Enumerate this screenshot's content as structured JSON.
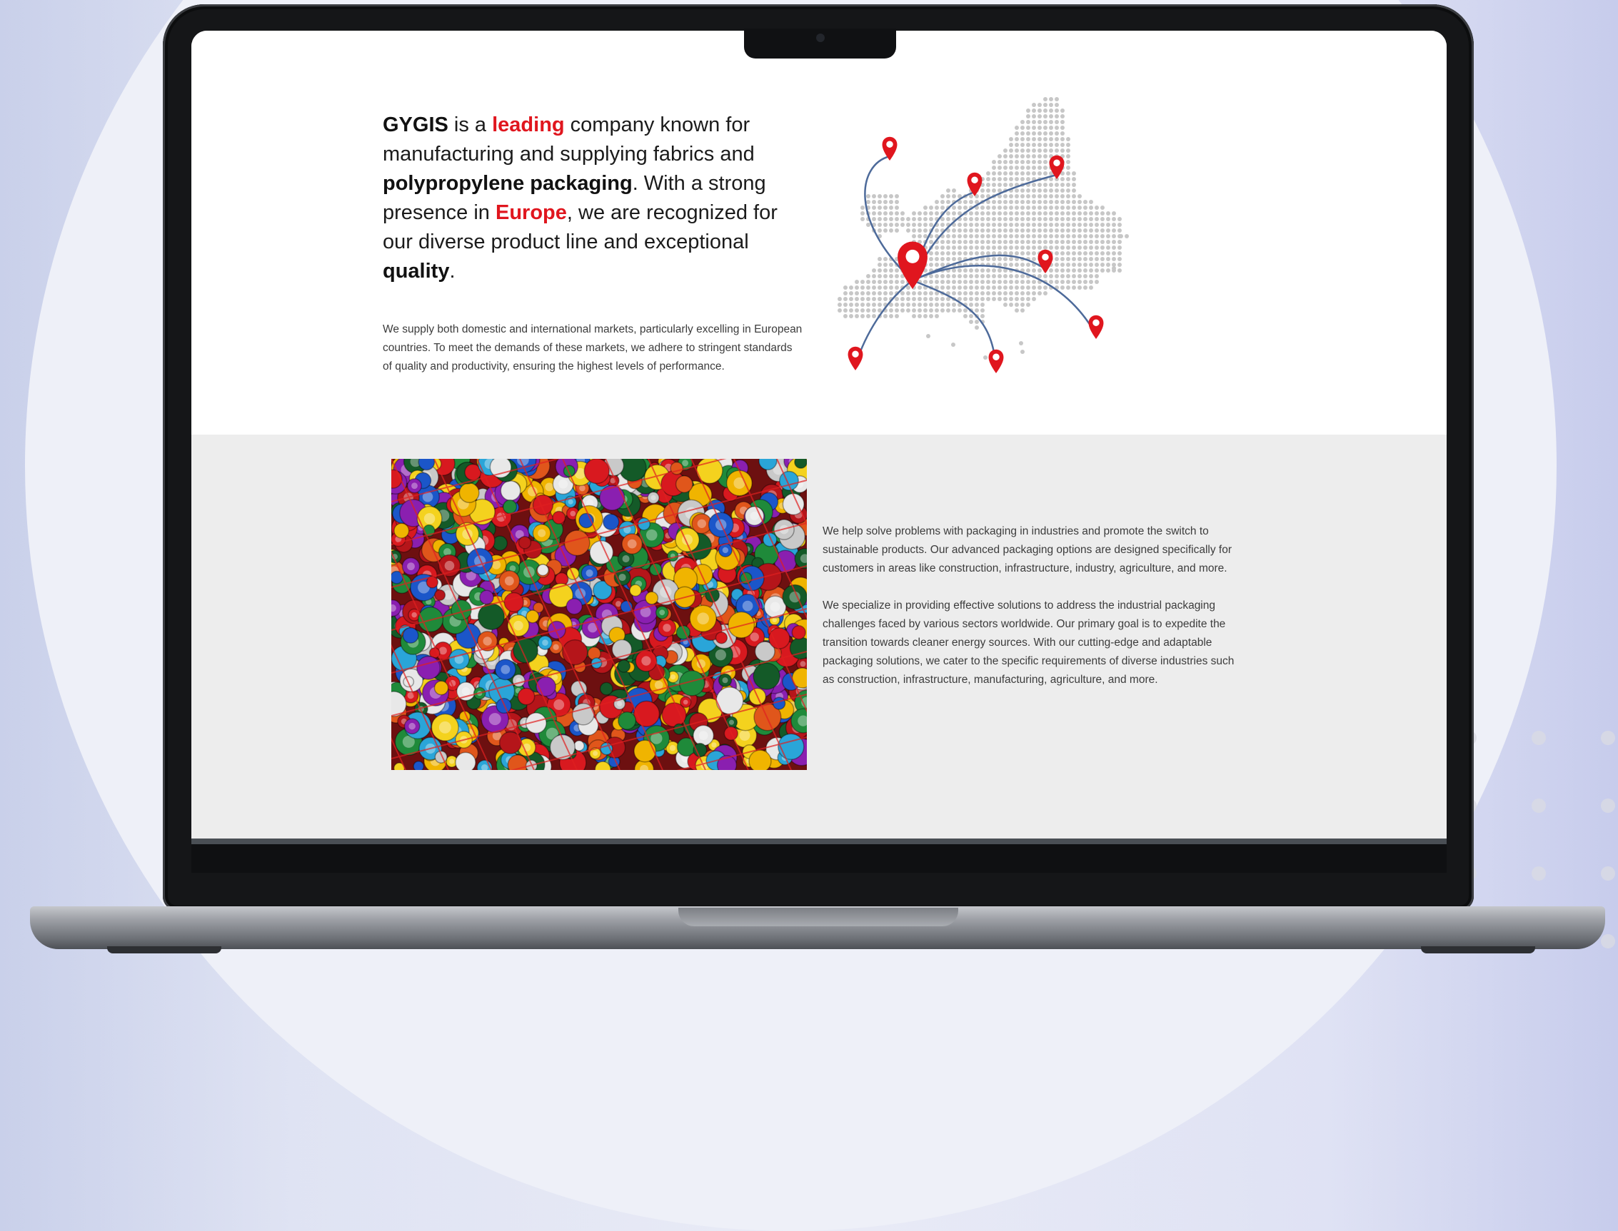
{
  "intro": {
    "headline": [
      {
        "text": "GYGIS",
        "style": "bold"
      },
      {
        "text": " is a ",
        "style": "normal"
      },
      {
        "text": "leading",
        "style": "red"
      },
      {
        "text": " company known for manufacturing and supplying fabrics and ",
        "style": "normal"
      },
      {
        "text": "polypropylene packaging",
        "style": "bold"
      },
      {
        "text": ". With a strong presence in ",
        "style": "normal"
      },
      {
        "text": "Europe",
        "style": "red"
      },
      {
        "text": ", we are recognized for our diverse product line and exceptional ",
        "style": "normal"
      },
      {
        "text": "quality",
        "style": "bold"
      },
      {
        "text": ".",
        "style": "normal"
      }
    ],
    "paragraph": "We supply both domestic and international markets, particularly excelling in European countries. To meet the demands of these markets, we adhere to stringent standards of quality and productivity, ensuring the highest levels of performance."
  },
  "map": {
    "icon": "europe-dot-map",
    "pin_color": "#e0161e",
    "route_color": "#4d6a9a",
    "dot_color": "#c7c7c7"
  },
  "about": {
    "image": "plastic-bottle-caps-photo",
    "paragraphs": [
      "We help solve problems with packaging in industries and promote the switch to sustainable products. Our advanced packaging options are designed specifically for customers in areas like construction, infrastructure, industry, agriculture, and more.",
      "We specialize in providing effective solutions to address the industrial packaging challenges faced by various sectors worldwide. Our primary goal is to expedite the transition towards cleaner energy sources. With our cutting-edge and adaptable packaging solutions, we cater to the specific requirements of diverse industries such as construction, infrastructure, manufacturing, agriculture, and more."
    ]
  },
  "colors": {
    "accent": "#e0161e",
    "text": "#1b1b1b",
    "section_gray": "#ededed"
  }
}
